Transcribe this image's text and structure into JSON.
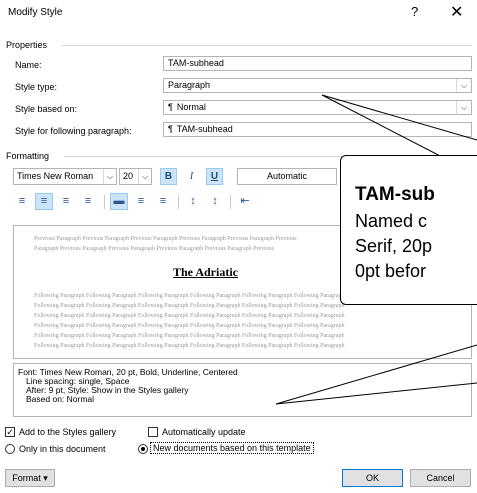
{
  "window": {
    "title": "Modify Style",
    "help_glyph": "?",
    "close_glyph": "✕"
  },
  "properties": {
    "section_label": "Properties",
    "name_label": "Name:",
    "name_value": "TAM-subhead",
    "type_label": "Style type:",
    "type_value": "Paragraph",
    "based_label": "Style based on:",
    "based_value": "Normal",
    "following_label": "Style for following paragraph:",
    "following_value": "TAM-subhead",
    "para_mark": "¶"
  },
  "formatting": {
    "section_label": "Formatting",
    "font": "Times New Roman",
    "size": "20",
    "bold": "B",
    "italic": "I",
    "underline": "U",
    "color": "Automatic"
  },
  "preview": {
    "previous_line_1": "Previous Paragraph Previous Paragraph Previous Paragraph Previous Paragraph Previous Paragraph Previous",
    "previous_line_2": "Paragraph Previous Paragraph Previous Paragraph Previous Paragraph Previous Paragraph Previous",
    "heading": "The Adriatic",
    "following_line": "Following Paragraph Following Paragraph Following Paragraph Following Paragraph Following Paragraph Following Paragraph"
  },
  "description": {
    "line1": "Font: Times New Roman, 20 pt, Bold, Underline, Centered",
    "line2": "Line spacing:  single, Space",
    "line3": "After:  9 pt, Style: Show in the Styles gallery",
    "line4": "Based on: Normal"
  },
  "options": {
    "add_gallery": "Add to the Styles gallery",
    "auto_update": "Automatically update",
    "only_doc": "Only in this document",
    "new_docs": "New documents based on this template",
    "add_gallery_checked": true,
    "auto_update_checked": false,
    "scope_selected": "new_docs"
  },
  "buttons": {
    "format": "Format ▾",
    "ok": "OK",
    "cancel": "Cancel"
  },
  "callout": {
    "title": "TAM-sub",
    "line1": "Named c",
    "line2": "Serif, 20p",
    "line3": "0pt befor"
  },
  "colors": {
    "accent": "#0078d7",
    "selected": "#cce4f7",
    "icon_blue": "#2b5797"
  }
}
